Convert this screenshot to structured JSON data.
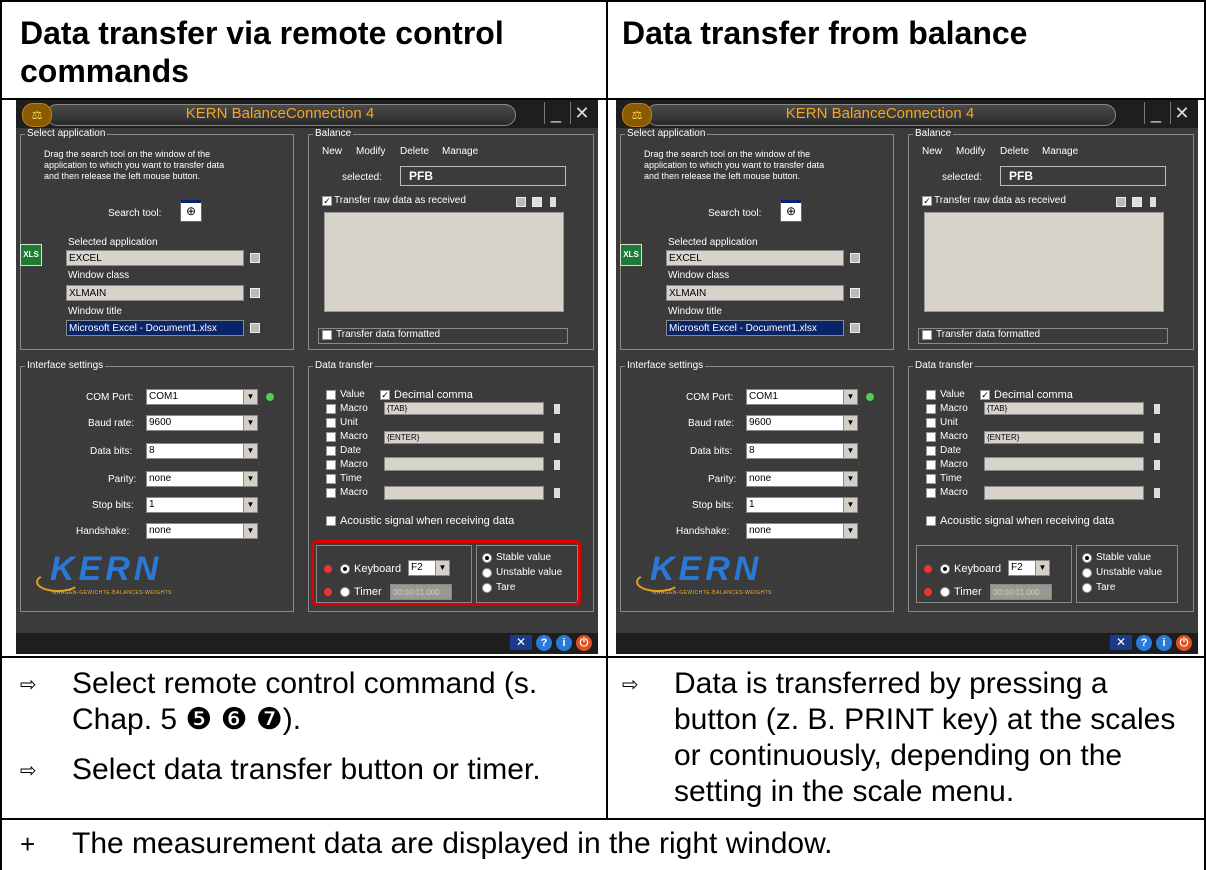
{
  "headers": {
    "left": "Data transfer via remote control commands",
    "right": "Data transfer from balance"
  },
  "notes": {
    "arrow_glyph": "⇨",
    "left_1": "Select remote control command (s. Chap. 5 ❺ ❻ ❼).",
    "left_2": "Select data transfer button or timer.",
    "right_1": "Data is transferred by pressing a button (z. B. PRINT key) at the scales or continuously, depending on the setting in the scale menu.",
    "footer_symbol": "+",
    "footer": "The measurement data are displayed in the right window."
  },
  "app": {
    "title": "KERN BalanceConnection 4",
    "select_application": {
      "label": "Select application",
      "instructions_1": "Drag the search tool on the window of the",
      "instructions_2": "application to which you want to transfer data",
      "instructions_3": "and then release the left mouse button.",
      "search_tool_label": "Search tool:",
      "selected_application_label": "Selected application",
      "selected_application_value": "EXCEL",
      "window_class_label": "Window class",
      "window_class_value": "XLMAIN",
      "window_title_label": "Window title",
      "window_title_value": "Microsoft Excel - Document1.xlsx"
    },
    "balance": {
      "label": "Balance",
      "menu_new": "New",
      "menu_modify": "Modify",
      "menu_delete": "Delete",
      "menu_manage": "Manage",
      "selected_label": "selected:",
      "selected_value": "PFB",
      "raw_data_label": "Transfer raw data as received",
      "formatted_label": "Transfer data formatted"
    },
    "interface_settings": {
      "label": "Interface settings",
      "com_port_label": "COM Port:",
      "com_port_value": "COM1",
      "baud_label": "Baud rate:",
      "baud_value": "9600",
      "data_bits_label": "Data bits:",
      "data_bits_value": "8",
      "parity_label": "Parity:",
      "parity_value": "none",
      "stop_bits_label": "Stop bits:",
      "stop_bits_value": "1",
      "handshake_label": "Handshake:",
      "handshake_value": "none"
    },
    "data_transfer": {
      "label": "Data transfer",
      "value_label": "Value",
      "decimal_comma_label": "Decimal comma",
      "macro_label": "Macro",
      "macro1_value": "{TAB}",
      "unit_label": "Unit",
      "macro2_value": "{ENTER}",
      "date_label": "Date",
      "macro3_value": "",
      "time_label": "Time",
      "macro4_value": "",
      "acoustic_label": "Acoustic signal when receiving data",
      "keyboard_label": "Keyboard",
      "keyboard_value": "F2",
      "timer_label": "Timer",
      "timer_value": "00:00:01.000",
      "stable_label": "Stable value",
      "unstable_label": "Unstable value",
      "tare_label": "Tare"
    },
    "logo": {
      "brand": "KERN",
      "tagline": "WAAGEN-GEWICHTE-BALANCES-WEIGHTS"
    }
  },
  "colors": {
    "app_bg": "#3b3b3b",
    "title": "#f5a623",
    "highlight": "#e00000",
    "kern_blue": "#2a79d6"
  }
}
